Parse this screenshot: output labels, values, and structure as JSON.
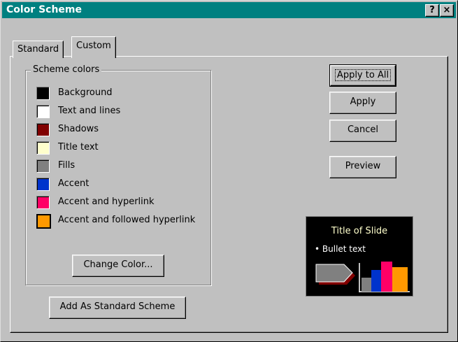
{
  "window": {
    "title": "Color Scheme",
    "help_button": "?",
    "close_button": "×"
  },
  "tabs": [
    {
      "label": "Standard",
      "active": false
    },
    {
      "label": "Custom",
      "active": true
    }
  ],
  "scheme_colors": {
    "label": "Scheme colors",
    "items": [
      {
        "label": "Background",
        "color": "#000000"
      },
      {
        "label": "Text and lines",
        "color": "#ffffff"
      },
      {
        "label": "Shadows",
        "color": "#800000"
      },
      {
        "label": "Title text",
        "color": "#ffffcc"
      },
      {
        "label": "Fills",
        "color": "#808080"
      },
      {
        "label": "Accent",
        "color": "#0033cc"
      },
      {
        "label": "Accent and hyperlink",
        "color": "#ff0066"
      },
      {
        "label": "Accent and followed hyperlink",
        "color": "#ff9900",
        "selected": true
      }
    ],
    "change_color_button": "Change Color..."
  },
  "add_standard_button": "Add As Standard Scheme",
  "actions": {
    "apply_to_all": "Apply to All",
    "apply": "Apply",
    "cancel": "Cancel",
    "preview": "Preview"
  },
  "preview_slide": {
    "title": "Title of Slide",
    "bullet": "•  Bullet text"
  }
}
